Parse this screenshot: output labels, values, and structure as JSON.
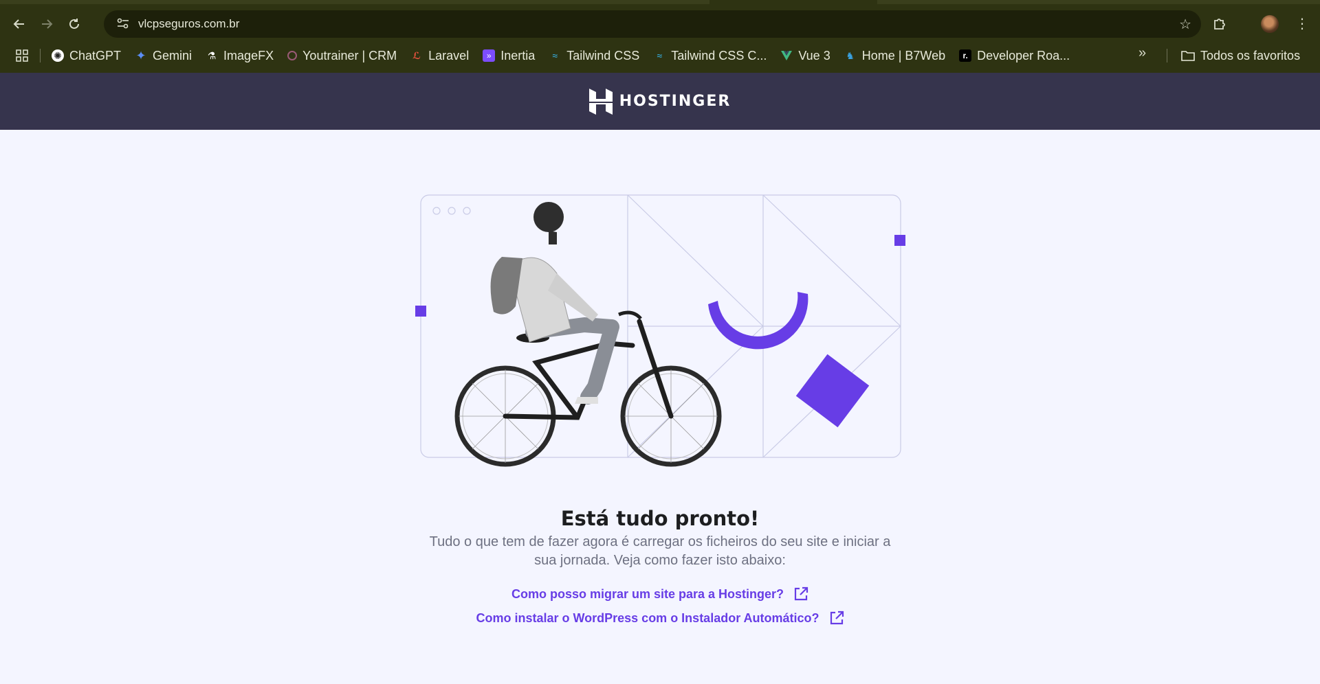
{
  "browser": {
    "url": "vlcpseguros.com.br",
    "bookmarks": [
      {
        "label": "ChatGPT",
        "icon": "chatgpt-icon"
      },
      {
        "label": "Gemini",
        "icon": "gemini-icon"
      },
      {
        "label": "ImageFX",
        "icon": "flask-icon"
      },
      {
        "label": "Youtrainer | CRM",
        "icon": "circle-icon"
      },
      {
        "label": "Laravel",
        "icon": "laravel-icon"
      },
      {
        "label": "Inertia",
        "icon": "inertia-icon"
      },
      {
        "label": "Tailwind CSS",
        "icon": "tailwind-icon"
      },
      {
        "label": "Tailwind CSS C...",
        "icon": "tailwind-icon"
      },
      {
        "label": "Vue 3",
        "icon": "vue-icon"
      },
      {
        "label": "Home | B7Web",
        "icon": "b7web-icon"
      },
      {
        "label": "Developer Roa...",
        "icon": "roadmap-icon"
      }
    ],
    "all_bookmarks_label": "Todos os favoritos",
    "overflow_label": "»"
  },
  "site": {
    "brand": "HOSTINGER",
    "title": "Está tudo pronto!",
    "subtitle": "Tudo o que tem de fazer agora é carregar os ficheiros do seu site e iniciar a sua jornada. Veja como fazer isto abaixo:",
    "links": [
      "Como posso migrar um site para a Hostinger?",
      "Como instalar o WordPress com o Instalador Automático?"
    ]
  },
  "colors": {
    "chrome_bg": "#2e3312",
    "omnibox_bg": "#1d200a",
    "header_bg": "#36344d",
    "page_bg": "#f4f5ff",
    "accent": "#673de6"
  }
}
